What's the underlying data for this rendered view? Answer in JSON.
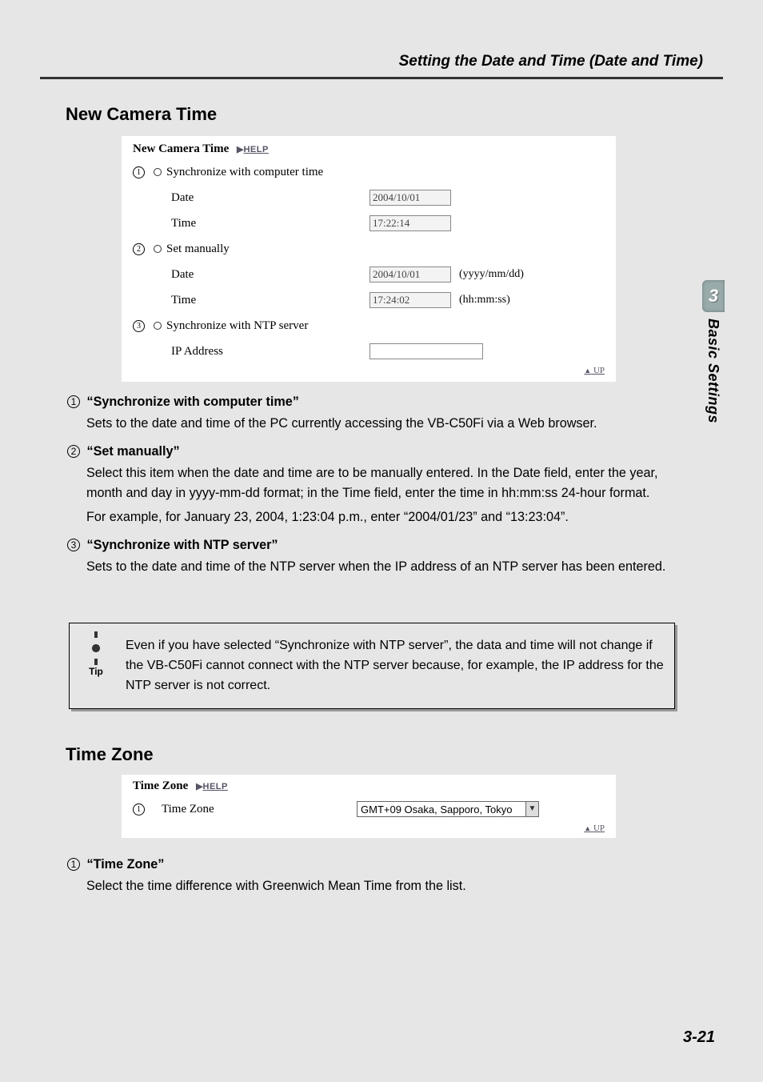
{
  "header": "Setting the Date and Time (Date and Time)",
  "side": {
    "chapter_num": "3",
    "chapter_title": "Basic Settings"
  },
  "page_number": "3-21",
  "section1": {
    "title": "New Camera Time",
    "shot": {
      "title": "New Camera Time",
      "help_label": "HELP",
      "up_label": "UP",
      "opt1": {
        "label": "Synchronize with computer time",
        "date_label": "Date",
        "date_value": "2004/10/01",
        "time_label": "Time",
        "time_value": "17:22:14"
      },
      "opt2": {
        "label": "Set manually",
        "date_label": "Date",
        "date_value": "2004/10/01",
        "date_hint": "(yyyy/mm/dd)",
        "time_label": "Time",
        "time_value": "17:24:02",
        "time_hint": "(hh:mm:ss)"
      },
      "opt3": {
        "label": "Synchronize with NTP server",
        "ip_label": "IP Address",
        "ip_value": ""
      }
    },
    "items": {
      "i1": {
        "title": "“Synchronize with computer time”",
        "desc": "Sets to the date and time of the PC currently accessing the VB-C50Fi via a Web browser."
      },
      "i2": {
        "title": "“Set manually”",
        "desc1": "Select this item when the date and time are to be manually entered. In the Date field, enter the year, month and day in yyyy-mm-dd format; in the Time field, enter the time in hh:mm:ss 24-hour format.",
        "desc2": "For example, for January 23, 2004, 1:23:04 p.m., enter “2004/01/23” and “13:23:04”."
      },
      "i3": {
        "title": "“Synchronize with NTP server”",
        "desc": "Sets to the date and time of the NTP server when the IP address of an NTP server has been entered."
      }
    },
    "tip": {
      "label": "Tip",
      "text": "Even if you have selected “Synchronize with NTP server”, the data and time will not change if the VB-C50Fi cannot connect with the NTP server because, for example, the IP address for the NTP server is not correct."
    }
  },
  "section2": {
    "title": "Time Zone",
    "shot": {
      "title": "Time Zone",
      "help_label": "HELP",
      "up_label": "UP",
      "label": "Time Zone",
      "value": "GMT+09 Osaka, Sapporo, Tokyo"
    },
    "items": {
      "i1": {
        "title": "“Time Zone”",
        "desc": "Select the time difference with Greenwich Mean Time from the list."
      }
    }
  }
}
